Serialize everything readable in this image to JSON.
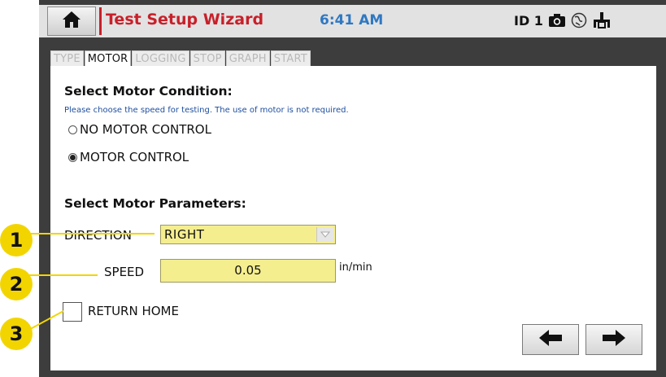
{
  "header": {
    "title": "Test Setup Wizard",
    "time": "6:41 AM",
    "device_id": "ID 1",
    "icons": [
      "home-icon",
      "camera-icon",
      "network-icon",
      "usb-icon"
    ]
  },
  "tabs": [
    {
      "label": "TYPE",
      "active": false
    },
    {
      "label": "MOTOR",
      "active": true
    },
    {
      "label": "LOGGING",
      "active": false
    },
    {
      "label": "STOP",
      "active": false
    },
    {
      "label": "GRAPH",
      "active": false
    },
    {
      "label": "START",
      "active": false
    }
  ],
  "motor_condition": {
    "heading": "Select Motor Condition:",
    "subtext": "Please choose the speed for testing.  The use of motor is not required.",
    "options": [
      {
        "label": "NO MOTOR CONTROL",
        "selected": false
      },
      {
        "label": "MOTOR CONTROL",
        "selected": true
      }
    ]
  },
  "motor_parameters": {
    "heading": "Select Motor Parameters:",
    "direction_label": "DIRECTION",
    "direction_value": "RIGHT",
    "speed_label": "SPEED",
    "speed_value": "0.05",
    "speed_unit": "in/min",
    "return_home_label": "RETURN HOME",
    "return_home_checked": false
  },
  "navigation": {
    "back_icon": "arrow-left-icon",
    "next_icon": "arrow-right-icon"
  },
  "callouts": [
    "1",
    "2",
    "3"
  ],
  "colors": {
    "title": "#c8202a",
    "clock": "#2f78c2",
    "field_bg": "#f5ee8f",
    "callout": "#f2d500",
    "subtext": "#1f4fa0"
  }
}
